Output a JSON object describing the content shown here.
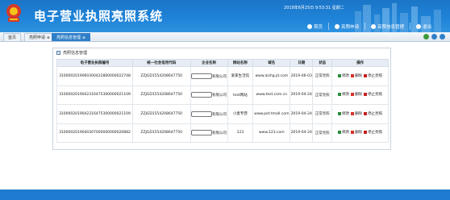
{
  "header": {
    "title": "电子营业执照亮照系统",
    "datetime": "2019年6月25日 9:53:31 星期二",
    "nav": [
      {
        "label": "首页",
        "icon": "home-icon"
      },
      {
        "label": "亮照申请",
        "icon": "apply-icon"
      },
      {
        "label": "亮照信息管理",
        "icon": "manage-icon"
      },
      {
        "label": "退出",
        "icon": "exit-icon"
      }
    ]
  },
  "tabs": [
    {
      "label": "首页"
    },
    {
      "label": "亮照申请"
    },
    {
      "label": "亮照信息管理"
    }
  ],
  "panel": {
    "title": "亮照信息管理",
    "columns": [
      "电子营业执照编号",
      "统一社会信用代码",
      "企业名称",
      "网站名称",
      "域名",
      "日期",
      "状态",
      "操作"
    ],
    "rows": [
      {
        "license_no": "3100002019060300422800000022748",
        "credit_code": "ZZJGD1554208647750",
        "company_suffix": "有限公司",
        "site_name": "爱家生活馆",
        "domain": "www.aishg.jd.com",
        "date": "2019-06-03",
        "status": "正常亮照"
      },
      {
        "license_no": "3100002019042316475300000021109",
        "credit_code": "ZZJGD1554208647750",
        "company_suffix": "有限公司",
        "site_name": "test网站",
        "domain": "www.test.com.cn",
        "date": "2019-04-24",
        "status": "正常亮照"
      },
      {
        "license_no": "3100002019042316475300000021109",
        "credit_code": "ZZJGD1554208647750",
        "company_suffix": "有限公司",
        "site_name": "小麦专营",
        "domain": "www.pet.tmall.com",
        "date": "2019-04-24",
        "status": "正常亮照"
      },
      {
        "license_no": "3100002019040307000000000020882",
        "credit_code": "ZZJGD1554208647750",
        "company_suffix": "有限公司",
        "site_name": "123",
        "domain": "www.123.com",
        "date": "2019-04-24",
        "status": "正常亮照"
      }
    ],
    "actions": {
      "edit": "修改",
      "delete": "删除",
      "stop": "停止亮照"
    }
  },
  "colors": {
    "brand": "#1f84d8",
    "header_bg": "#1b75c8",
    "active_tab": "#2f7fc8",
    "delete": "#d9302a",
    "stop": "#c81f1f",
    "edit": "#2c8a3c"
  }
}
